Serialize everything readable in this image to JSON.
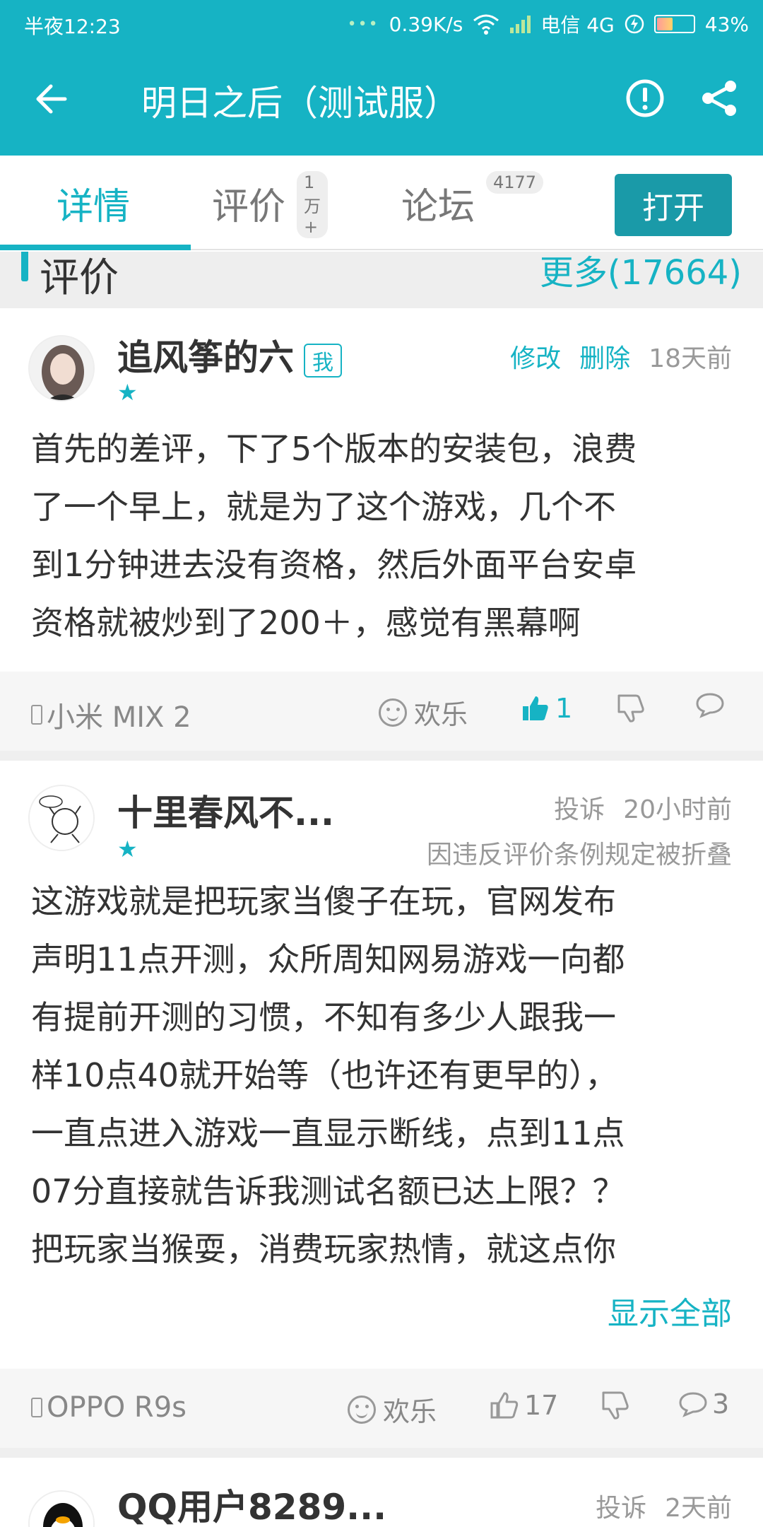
{
  "status_bar": {
    "time": "半夜12:23",
    "network_speed": "0.39K/s",
    "carrier": "电信 4G",
    "battery": "43%",
    "battery_level": 0.43
  },
  "app_bar": {
    "title": "明日之后（测试服）",
    "back_icon": "arrow-left-icon",
    "report_icon": "alert-circle-icon",
    "share_icon": "share-icon"
  },
  "tabs": [
    {
      "label": "详情",
      "badge": "",
      "active": true
    },
    {
      "label": "评价",
      "badge": "1万+",
      "active": false
    },
    {
      "label": "论坛",
      "badge": "4177",
      "active": false
    }
  ],
  "open_button": "打开",
  "section": {
    "title": "评价",
    "more": "更多(17664)"
  },
  "reviews": [
    {
      "user": "追风筝的六",
      "me_tag": "我",
      "stars": 1,
      "actions": [
        "修改",
        "删除"
      ],
      "time": "18天前",
      "folded_note": "",
      "content_lines": [
        "首先的差评，下了5个版本的安装包，浪费",
        "了一个早上，就是为了这个游戏，几个不",
        "到1分钟进去没有资格，然后外面平台安卓",
        "资格就被炒到了200＋，感觉有黑幕啊"
      ],
      "show_all": "",
      "device": "小米 MIX 2",
      "mood": "欢乐",
      "likes": "1",
      "liked": true,
      "comments": ""
    },
    {
      "user": "十里春风不...",
      "me_tag": "",
      "stars": 1,
      "actions": [
        "投诉"
      ],
      "time": "20小时前",
      "folded_note": "因违反评价条例规定被折叠",
      "content_lines": [
        "这游戏就是把玩家当傻子在玩，官网发布",
        "声明11点开测，众所周知网易游戏一向都",
        "有提前开测的习惯，不知有多少人跟我一",
        "样10点40就开始等（也许还有更早的），",
        "一直点进入游戏一直显示断线，点到11点",
        "07分直接就告诉我测试名额已达上限？？",
        "把玩家当猴耍，消费玩家热情，就这点你"
      ],
      "show_all": "显示全部",
      "device": "OPPO R9s",
      "mood": "欢乐",
      "likes": "17",
      "liked": false,
      "comments": "3"
    },
    {
      "user": "QQ用户8289...",
      "actions": [
        "投诉"
      ],
      "time": "2天前"
    }
  ]
}
